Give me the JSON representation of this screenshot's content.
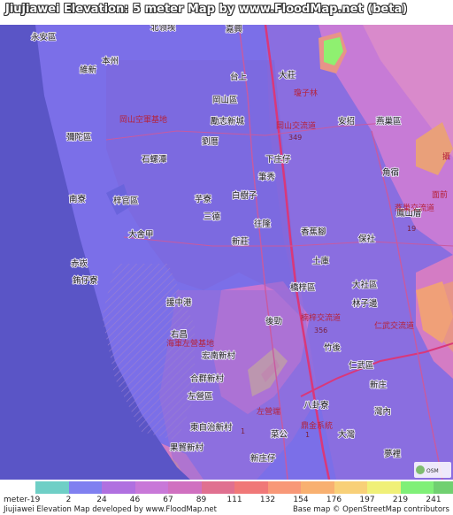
{
  "title": "Jiujiawei Elevation: 5 meter Map by www.FloodMap.net (beta)",
  "map": {
    "place_labels": [
      {
        "id": "yonganqu",
        "text": "永安區"
      },
      {
        "id": "beilingxun",
        "text": "北领埃"
      },
      {
        "id": "jiaxing",
        "text": "嘉興"
      },
      {
        "id": "benzhou",
        "text": "本州"
      },
      {
        "id": "weixin",
        "text": "維新"
      },
      {
        "id": "taishang",
        "text": "台上"
      },
      {
        "id": "dazhuang",
        "text": "大莊"
      },
      {
        "id": "ganggshanqu",
        "text": "岡山區"
      },
      {
        "id": "lizhixincheng",
        "text": "勵志新城"
      },
      {
        "id": "mituoqu",
        "text": "彌陀區"
      },
      {
        "id": "anzhao",
        "text": "安招"
      },
      {
        "id": "yancaoqu",
        "text": "燕巢區"
      },
      {
        "id": "liucuo",
        "text": "劉厝"
      },
      {
        "id": "shiluotan",
        "text": "石螺潭"
      },
      {
        "id": "xiazhuangzi",
        "text": "下庄仔"
      },
      {
        "id": "jiaosu",
        "text": "角宿"
      },
      {
        "id": "xiulian",
        "text": "筆秀"
      },
      {
        "id": "nanliao",
        "text": "南寮"
      },
      {
        "id": "zigongqu",
        "text": "梓官區"
      },
      {
        "id": "yuliao",
        "text": "芋寮"
      },
      {
        "id": "baishuzi",
        "text": "白樹子"
      },
      {
        "id": "fengshancuo",
        "text": "鳳山厝"
      },
      {
        "id": "sande",
        "text": "三德"
      },
      {
        "id": "wanglong",
        "text": "往隆"
      },
      {
        "id": "dashejia",
        "text": "大舍甲"
      },
      {
        "id": "xinzhuang",
        "text": "新莊"
      },
      {
        "id": "xiangjiaojiao",
        "text": "香蕉腳"
      },
      {
        "id": "baoshe",
        "text": "保社"
      },
      {
        "id": "chikan",
        "text": "赤崁"
      },
      {
        "id": "tuku",
        "text": "土庫"
      },
      {
        "id": "zhuzailiao",
        "text": "銪仔寮"
      },
      {
        "id": "qiaotouqu",
        "text": "橋梓區"
      },
      {
        "id": "dashequ",
        "text": "大社區"
      },
      {
        "id": "linzibian",
        "text": "林子邊"
      },
      {
        "id": "yuanzhonggang",
        "text": "援中港"
      },
      {
        "id": "houqin",
        "text": "後勁"
      },
      {
        "id": "youchang",
        "text": "右昌"
      },
      {
        "id": "zhuhou",
        "text": "竹後"
      },
      {
        "id": "hongnanxincun",
        "text": "宏南新村"
      },
      {
        "id": "renwuqu",
        "text": "仁武區"
      },
      {
        "id": "hequnxincun",
        "text": "合群新村"
      },
      {
        "id": "xinzhuang2",
        "text": "新庄"
      },
      {
        "id": "zuoyingqu",
        "text": "左營區"
      },
      {
        "id": "baguaiao",
        "text": "八卦寮"
      },
      {
        "id": "wanei",
        "text": "灣內"
      },
      {
        "id": "dongzizhixincun",
        "text": "東自治新村"
      },
      {
        "id": "caigong",
        "text": "菜公"
      },
      {
        "id": "dawan",
        "text": "大灣"
      },
      {
        "id": "guoxianxincun",
        "text": "果貿新村"
      },
      {
        "id": "xinzhuangzi",
        "text": "新庄仔"
      },
      {
        "id": "mengli",
        "text": "夢裡"
      }
    ],
    "road_labels": [
      {
        "id": "r349",
        "text": "349"
      },
      {
        "id": "r19",
        "text": "19"
      },
      {
        "id": "r356",
        "text": "356"
      },
      {
        "id": "r1",
        "text": "1"
      },
      {
        "id": "r1b",
        "text": "1"
      },
      {
        "id": "gangshanjct",
        "text": "岡山交流道"
      },
      {
        "id": "yanchaojct",
        "text": "燕巢交流道"
      },
      {
        "id": "nanzijct",
        "text": "楠梓交流道"
      },
      {
        "id": "renwujct",
        "text": "仁武交流道"
      },
      {
        "id": "zuoyingjct",
        "text": "左營端"
      },
      {
        "id": "dingjinjct",
        "text": "鼎金系統"
      },
      {
        "id": "gangshanbase",
        "text": "岡山空軍基地"
      },
      {
        "id": "yuanhuang",
        "text": "瓊子林"
      },
      {
        "id": "mianqian",
        "text": "面前"
      },
      {
        "id": "jiaotou",
        "text": "攝"
      },
      {
        "id": "zuoyingbase",
        "text": "海軍左營基地"
      }
    ]
  },
  "legend": {
    "unit_label": "meter",
    "ticks": [
      "-19",
      "2",
      "24",
      "46",
      "67",
      "89",
      "111",
      "132",
      "154",
      "176",
      "197",
      "219",
      "241"
    ],
    "colors": [
      "#6fcfc6",
      "#8080f0",
      "#b070e0",
      "#c878d8",
      "#d070c0",
      "#e07090",
      "#f07878",
      "#f89878",
      "#f8b070",
      "#f8d078",
      "#f0f078",
      "#80f078",
      "#70d070"
    ]
  },
  "footer": {
    "left": "Jiujiawei Elevation Map developed by www.FloodMap.net",
    "right": "Base map © OpenStreetMap contributors"
  },
  "colors": {
    "sea": "#5c5cc8",
    "lowland": "#7a6ee8",
    "urban": "#a36fd6",
    "hills": "#d97cc4",
    "peak": "#8ff070",
    "highway": "#d9387a",
    "road": "#c85aa0"
  }
}
